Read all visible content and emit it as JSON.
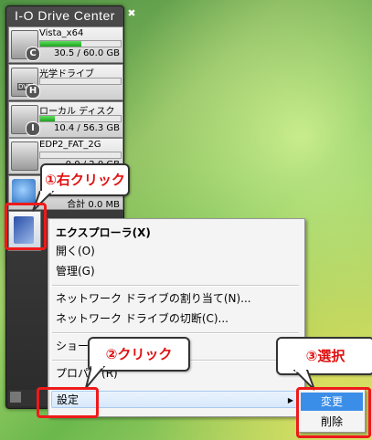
{
  "gadget": {
    "title": "I-O Drive Center",
    "close_glyph": "✖",
    "wrench_glyph": "🔧",
    "drives": [
      {
        "letter": "C",
        "name": "Vista_x64",
        "size": "30.5 / 60.0 GB",
        "usage": 0.51,
        "icon": "hard-disk-icon"
      },
      {
        "letter": "H",
        "name": "光学ドライブ",
        "size": "",
        "usage": 0,
        "icon": "dvd-drive-icon",
        "badge": "DVD"
      },
      {
        "letter": "I",
        "name": "ローカル ディスク",
        "size": "10.4 / 56.3 GB",
        "usage": 0.18,
        "icon": "hard-disk-icon"
      },
      {
        "letter": "",
        "name": "EDP2_FAT_2G",
        "size": "0.0 / 2.0 GB",
        "usage": 0,
        "icon": "removable-drive-icon"
      }
    ],
    "total": "合計 0.0 MB"
  },
  "callouts": {
    "right_click": "①右クリック",
    "click": "②クリック",
    "select": "③選択"
  },
  "context_menu": {
    "items": [
      {
        "label": "エクスプローラ(X)",
        "bold": true
      },
      {
        "label": "開く(O)"
      },
      {
        "label": "管理(G)"
      },
      {
        "label": "ネットワーク ドライブの割り当て(N)..."
      },
      {
        "label": "ネットワーク ドライブの切断(C)..."
      },
      {
        "label": "ショー"
      },
      {
        "label": "プロパ"
      },
      {
        "label": "設定"
      }
    ],
    "properties_suffix": "(R)",
    "submenu_arrow": "▶"
  },
  "submenu": {
    "items": [
      {
        "label": "変更",
        "highlighted": true
      },
      {
        "label": "削除"
      }
    ]
  },
  "colors": {
    "menu_highlight": "#3b8ee8",
    "callout_text": "#e01010",
    "callout_border": "#ee1a1a"
  }
}
